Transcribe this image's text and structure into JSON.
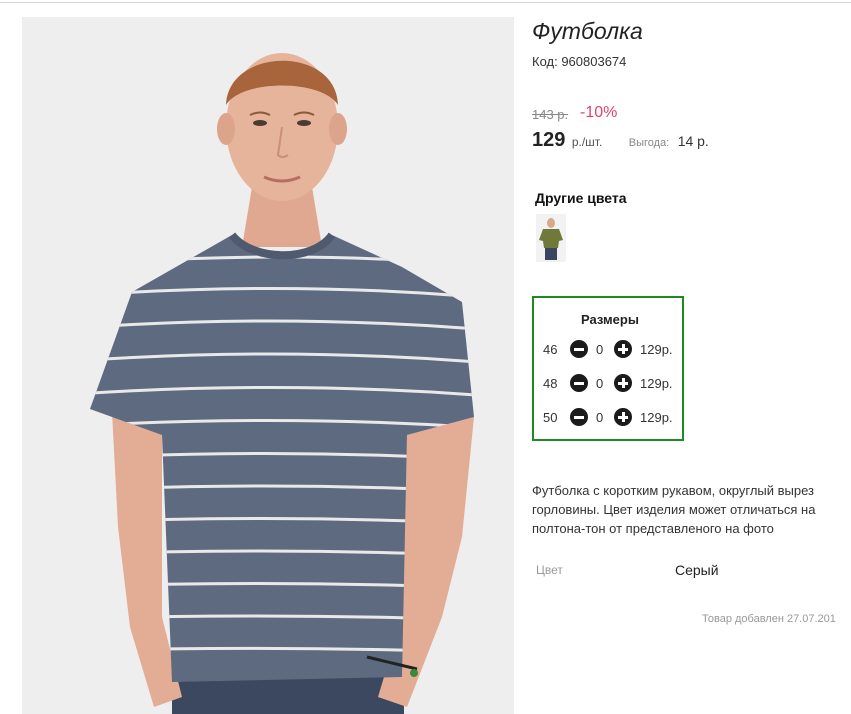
{
  "product": {
    "title": "Футболка",
    "code": "Код: 960803674",
    "old_price": "143 р.",
    "discount": "-10%",
    "price": "129",
    "price_unit": "р./шт.",
    "benefit_label": "Выгода:",
    "benefit_value": "14 р.",
    "other_colors_label": "Другие цвета",
    "other_color_thumb": "olive-tshirt-thumbnail",
    "description": "Футболка с коротким рукавом, округлый вырез горловины. Цвет изделия может отличаться на полтона-тон от представленого на фото",
    "attribute_label": "Цвет",
    "attribute_value": "Серый",
    "added": "Товар добавлен 27.07.201"
  },
  "sizes": {
    "title": "Размеры",
    "rows": [
      {
        "size": "46",
        "qty": "0",
        "price": "129р."
      },
      {
        "size": "48",
        "qty": "0",
        "price": "129р."
      },
      {
        "size": "50",
        "qty": "0",
        "price": "129р."
      }
    ]
  },
  "colors": {
    "discount": "#e0436b",
    "sizes_border": "#1f8a1f",
    "shirt": "#5e6a80"
  },
  "icons": {
    "minus": "minus-circle-icon",
    "plus": "plus-circle-icon"
  }
}
